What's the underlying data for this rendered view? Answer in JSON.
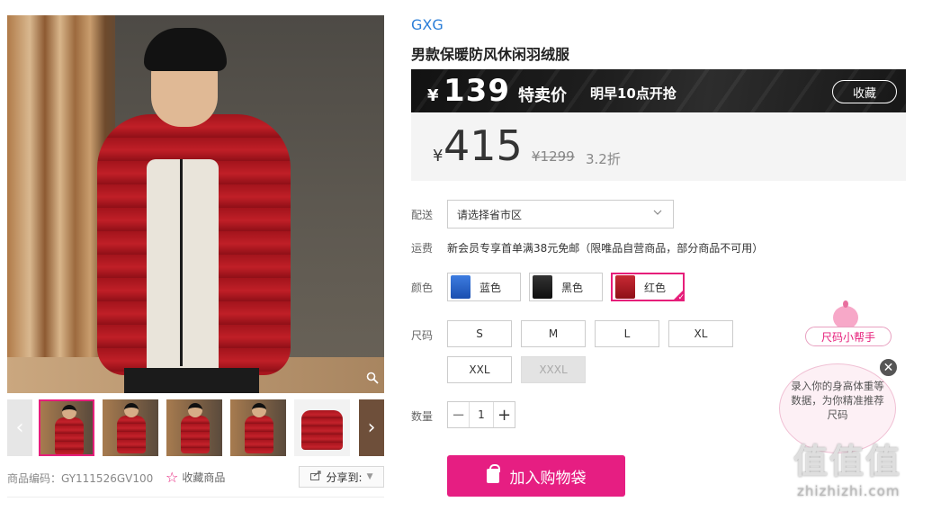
{
  "gallery": {
    "prev_label": "‹",
    "next_label": "›",
    "zoom_icon": "zoom-icon"
  },
  "meta": {
    "product_code": "商品编码：GY111526GV100",
    "favorite_label": "收藏商品",
    "share_label": "分享到:"
  },
  "product": {
    "brand": "GXG",
    "title": "男款保暖防风休闲羽绒服"
  },
  "sale_bar": {
    "currency": "¥",
    "price": "139",
    "tag": "特卖价",
    "start_time": "明早10点开抢",
    "collect_label": "收藏"
  },
  "price_box": {
    "currency": "¥",
    "price": "415",
    "original": "¥1299",
    "discount": "3.2折"
  },
  "delivery": {
    "label": "配送",
    "select_placeholder": "请选择省市区"
  },
  "shipping": {
    "label": "运费",
    "text": "新会员专享首单满38元免邮（限唯品自营商品，部分商品不可用）"
  },
  "colors": {
    "label": "颜色",
    "options": [
      {
        "name": "蓝色",
        "swatch": "#1f5fc9"
      },
      {
        "name": "黑色",
        "swatch": "#1a1a1a"
      },
      {
        "name": "红色",
        "swatch": "#b0182a"
      }
    ],
    "selected": "红色",
    "accent": "#e61e7a"
  },
  "sizes": {
    "label": "尺码",
    "options": [
      "S",
      "M",
      "L",
      "XL",
      "XXL",
      "XXXL"
    ],
    "disabled": [
      "XXXL"
    ]
  },
  "quantity": {
    "label": "数量",
    "minus": "−",
    "value": "1",
    "plus": "+"
  },
  "cart": {
    "label": "加入购物袋",
    "color": "#e61e82"
  },
  "size_helper": {
    "tag": "尺码小帮手",
    "bubble": "录入你的身高体重等数据，为你精准推荐尺码",
    "close": "✕"
  },
  "watermark": {
    "logo": "值值值",
    "url": "zhizhizhi.com"
  }
}
